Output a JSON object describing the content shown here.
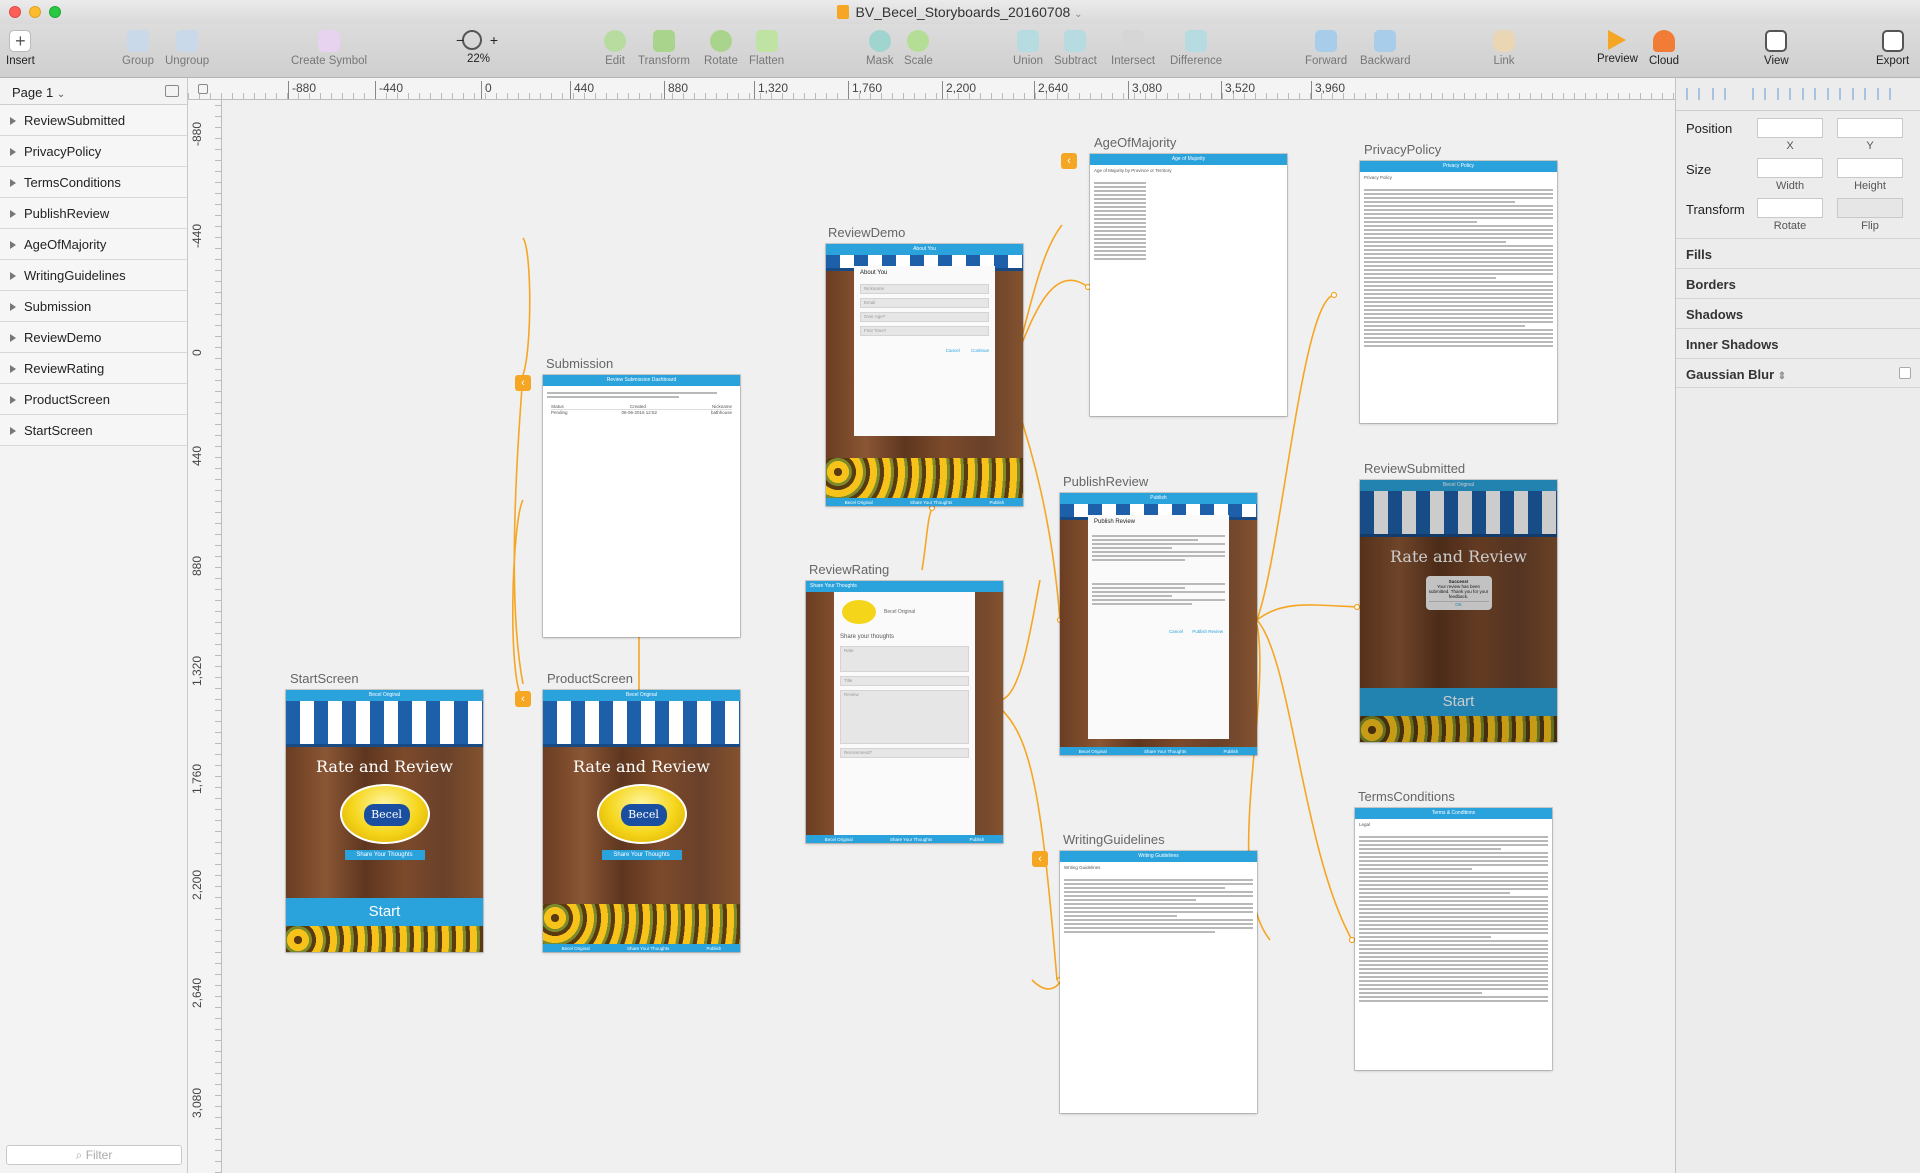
{
  "window": {
    "title": "BV_Becel_Storyboards_20160708"
  },
  "toolbar": {
    "items": [
      {
        "label": "Insert",
        "icon": "plus-icon"
      },
      {
        "label": "Group",
        "icon": "group-icon"
      },
      {
        "label": "Ungroup",
        "icon": "ungroup-icon"
      },
      {
        "label": "Create Symbol",
        "icon": "symbol-icon"
      },
      {
        "label": "22%",
        "icon": "zoom-icon"
      },
      {
        "label": "Edit",
        "icon": "edit-icon"
      },
      {
        "label": "Transform",
        "icon": "transform-icon"
      },
      {
        "label": "Rotate",
        "icon": "rotate-icon"
      },
      {
        "label": "Flatten",
        "icon": "flatten-icon"
      },
      {
        "label": "Mask",
        "icon": "mask-icon"
      },
      {
        "label": "Scale",
        "icon": "scale-icon"
      },
      {
        "label": "Union",
        "icon": "union-icon"
      },
      {
        "label": "Subtract",
        "icon": "subtract-icon"
      },
      {
        "label": "Intersect",
        "icon": "intersect-icon"
      },
      {
        "label": "Difference",
        "icon": "difference-icon"
      },
      {
        "label": "Forward",
        "icon": "forward-icon"
      },
      {
        "label": "Backward",
        "icon": "backward-icon"
      },
      {
        "label": "Link",
        "icon": "link-icon"
      },
      {
        "label": "Preview",
        "icon": "preview-icon"
      },
      {
        "label": "Cloud",
        "icon": "cloud-icon"
      },
      {
        "label": "View",
        "icon": "view-icon"
      },
      {
        "label": "Export",
        "icon": "export-icon"
      }
    ],
    "zoom_minus": "−",
    "zoom_plus": "+"
  },
  "sidebar": {
    "page": "Page 1",
    "layers": [
      "ReviewSubmitted",
      "PrivacyPolicy",
      "TermsConditions",
      "PublishReview",
      "AgeOfMajority",
      "WritingGuidelines",
      "Submission",
      "ReviewDemo",
      "ReviewRating",
      "ProductScreen",
      "StartScreen"
    ],
    "filter_placeholder": "Filter"
  },
  "rulers": {
    "top": [
      "-880",
      "-440",
      "0",
      "440",
      "880",
      "1,320",
      "1,760",
      "2,200",
      "2,640",
      "3,080",
      "3,520",
      "3,960"
    ],
    "left": [
      "-880",
      "-440",
      "0",
      "440",
      "880",
      "1,320",
      "1,760",
      "2,200",
      "2,640",
      "3,080"
    ]
  },
  "artboards": {
    "start": {
      "name": "StartScreen",
      "bar": "Becel Original",
      "title": "Rate and Review",
      "logo": "Becel",
      "share": "Share Your Thoughts",
      "start": "Start"
    },
    "product": {
      "name": "ProductScreen",
      "bar": "Becel Original",
      "title": "Rate and Review",
      "logo": "Becel",
      "share": "Share Your Thoughts",
      "tabs": [
        "Becel Original",
        "Share Your Thoughts",
        "Publish"
      ]
    },
    "submission": {
      "name": "Submission",
      "bar": "Review Submission Dashboard",
      "cols": [
        "Status",
        "Created",
        "Nickname"
      ],
      "row": [
        "Pending",
        "06-06-2016 12:52",
        "bathhouse"
      ]
    },
    "demo": {
      "name": "ReviewDemo",
      "bar": "About You",
      "heading": "About You",
      "fields": [
        "Nickname",
        "Email",
        "Over Age?",
        "First Time?"
      ],
      "buttons": [
        "Cancel",
        "Continue"
      ],
      "tabs": [
        "Becel Original",
        "Share Your Thoughts",
        "Publish"
      ]
    },
    "rating": {
      "name": "ReviewRating",
      "bar": "Share Your Thoughts",
      "product": "Becel Original",
      "heading": "Share your thoughts",
      "fields": [
        "Rate",
        "Title",
        "Review",
        "Recommend?"
      ],
      "tabs": [
        "Becel Original",
        "Share Your Thoughts",
        "Publish"
      ]
    },
    "majority": {
      "name": "AgeOfMajority",
      "bar": "Age of Majority",
      "heading": "Age of Majority by Province or Territory"
    },
    "publish": {
      "name": "PublishReview",
      "bar": "Publish",
      "heading": "Publish Review",
      "buttons": [
        "Cancel",
        "Publish Review"
      ],
      "tabs": [
        "Becel Original",
        "Share Your Thoughts",
        "Publish"
      ]
    },
    "writing": {
      "name": "WritingGuidelines",
      "bar": "Writing Guidelines",
      "heading": "Writing Guidelines"
    },
    "privacy": {
      "name": "PrivacyPolicy",
      "bar": "Privacy Policy",
      "heading": "Privacy Policy"
    },
    "submitted": {
      "name": "ReviewSubmitted",
      "bar": "Becel Original",
      "title": "Rate and Review",
      "success": "Success!",
      "msg": "Your review has been submitted. Thank you for your feedback.",
      "ok": "OK",
      "start": "Start"
    },
    "terms": {
      "name": "TermsConditions",
      "bar": "Terms & Conditions",
      "heading": "Legal"
    }
  },
  "inspector": {
    "position": "Position",
    "size": "Size",
    "transform": "Transform",
    "x": "X",
    "y": "Y",
    "width": "Width",
    "height": "Height",
    "rotate": "Rotate",
    "flip": "Flip",
    "sections": [
      "Fills",
      "Borders",
      "Shadows",
      "Inner Shadows",
      "Gaussian Blur"
    ]
  },
  "colors": {
    "accent": "#2aa2dc",
    "connector": "#f5a623",
    "awning": "#1d5fa8"
  }
}
